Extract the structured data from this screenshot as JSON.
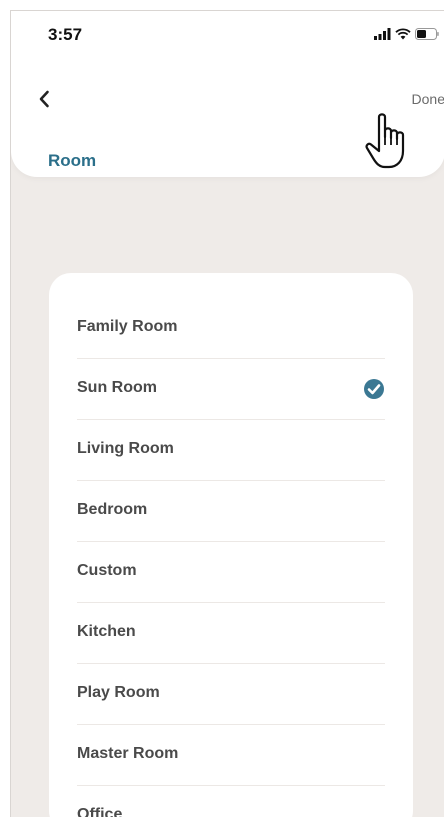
{
  "status_bar": {
    "time": "3:57"
  },
  "nav": {
    "done_label": "Done",
    "title": "Room"
  },
  "rooms": {
    "items": [
      {
        "label": "Family Room",
        "selected": false
      },
      {
        "label": "Sun Room",
        "selected": true
      },
      {
        "label": "Living Room",
        "selected": false
      },
      {
        "label": "Bedroom",
        "selected": false
      },
      {
        "label": "Custom",
        "selected": false
      },
      {
        "label": "Kitchen",
        "selected": false
      },
      {
        "label": "Play Room",
        "selected": false
      },
      {
        "label": "Master Room",
        "selected": false
      },
      {
        "label": "Office",
        "selected": false
      }
    ]
  },
  "colors": {
    "accent": "#2b6f8a",
    "background": "#efebe8",
    "check": "#3b7893"
  }
}
